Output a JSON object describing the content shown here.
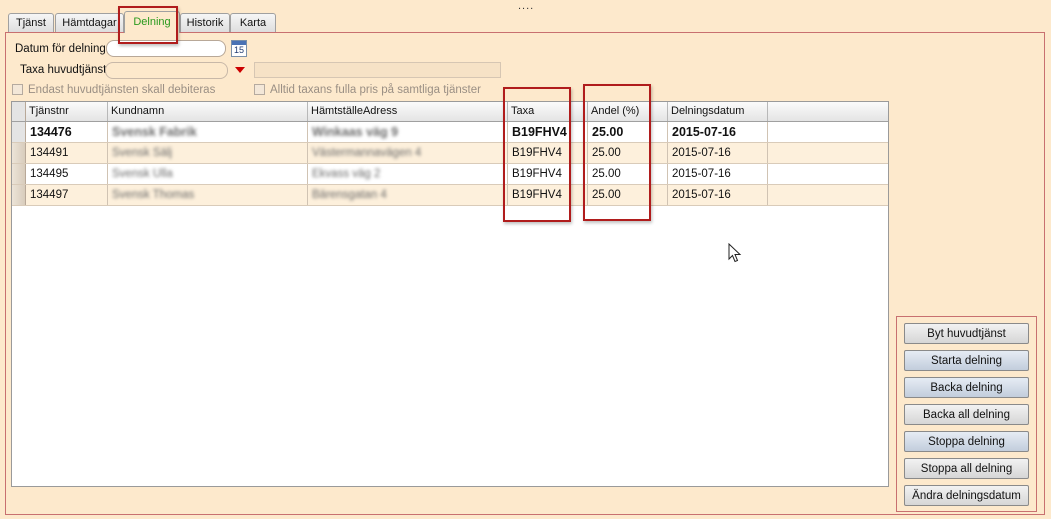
{
  "tabs": [
    {
      "label": "Tjänst",
      "active": false
    },
    {
      "label": "Hämtdagar",
      "active": false
    },
    {
      "label": "Delning",
      "active": true
    },
    {
      "label": "Historik",
      "active": false
    },
    {
      "label": "Karta",
      "active": false
    }
  ],
  "form": {
    "datum_label": "Datum för delning",
    "datum_value": "",
    "calendar_day": "15",
    "taxa_label": "Taxa huvudtjänst",
    "taxa_value": "",
    "checkbox_endast": "Endast huvudtjänsten skall debiteras",
    "checkbox_alltid": "Alltid taxans fulla pris på samtliga tjänster"
  },
  "table": {
    "columns": [
      "Tjänstnr",
      "Kundnamn",
      "HämtställeAdress",
      "Taxa",
      "Andel (%)",
      "Delningsdatum"
    ],
    "rows": [
      {
        "tjanstnr": "134476",
        "kundnamn": "Svensk Fabrik",
        "adress": "Winkaas väg 9",
        "taxa": "B19FHV4",
        "andel": "25.00",
        "datum": "2015-07-16"
      },
      {
        "tjanstnr": "134491",
        "kundnamn": "Svensk Sälj",
        "adress": "Västermannavägen 4",
        "taxa": "B19FHV4",
        "andel": "25.00",
        "datum": "2015-07-16"
      },
      {
        "tjanstnr": "134495",
        "kundnamn": "Svensk Ulla",
        "adress": "Ekvass väg 2",
        "taxa": "B19FHV4",
        "andel": "25.00",
        "datum": "2015-07-16"
      },
      {
        "tjanstnr": "134497",
        "kundnamn": "Svensk Thomas",
        "adress": "Bärensgatan 4",
        "taxa": "B19FHV4",
        "andel": "25.00",
        "datum": "2015-07-16"
      }
    ]
  },
  "buttons": {
    "byt": "Byt huvudtjänst",
    "starta": "Starta delning",
    "backa": "Backa delning",
    "backa_all": "Backa all delning",
    "stoppa": "Stoppa delning",
    "stoppa_all": "Stoppa all delning",
    "andra": "Ändra delningsdatum"
  },
  "colors": {
    "background": "#fde9cc",
    "active_tab_text": "#2a9a1e",
    "highlight": "#b01c1c"
  }
}
